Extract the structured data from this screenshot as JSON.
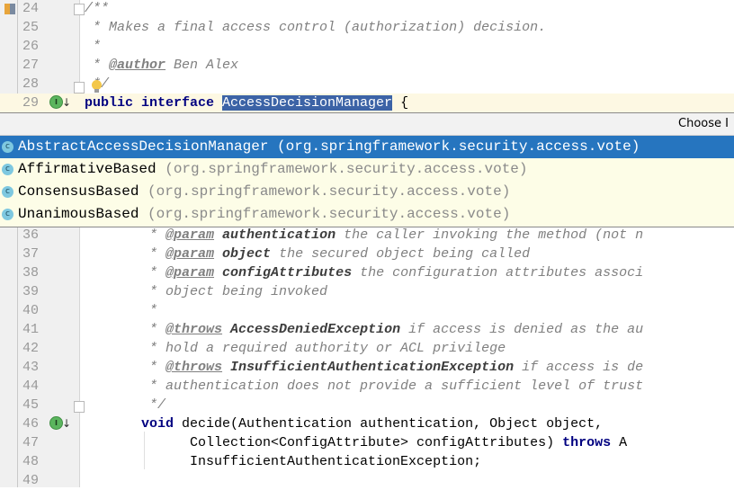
{
  "editor": {
    "lines_top": [
      {
        "num": "24",
        "parts": [
          {
            "t": "/**",
            "c": "cm"
          }
        ]
      },
      {
        "num": "25",
        "parts": [
          {
            "t": " * Makes a final access control (authorization) decision.",
            "c": "cm"
          }
        ]
      },
      {
        "num": "26",
        "parts": [
          {
            "t": " *",
            "c": "cm"
          }
        ]
      },
      {
        "num": "27",
        "parts": [
          {
            "t": " * ",
            "c": "cm"
          },
          {
            "t": "@author",
            "c": "tag"
          },
          {
            "t": " Ben Alex",
            "c": "cm"
          }
        ]
      },
      {
        "num": "28",
        "parts": [
          {
            "t": " */",
            "c": "cm"
          }
        ]
      },
      {
        "num": "29",
        "parts": [
          {
            "t": "public interface ",
            "c": "kw"
          },
          {
            "t": "AccessDecisionManager",
            "c": "sel"
          },
          {
            "t": " {",
            "c": ""
          }
        ]
      }
    ],
    "lines_bottom": [
      {
        "num": "36",
        "parts": [
          {
            "t": "        * ",
            "c": "cm"
          },
          {
            "t": "@param",
            "c": "tag"
          },
          {
            "t": " ",
            "c": "cm"
          },
          {
            "t": "authentication",
            "c": "pname"
          },
          {
            "t": " the caller invoking the method (not n",
            "c": "cm"
          }
        ]
      },
      {
        "num": "37",
        "parts": [
          {
            "t": "        * ",
            "c": "cm"
          },
          {
            "t": "@param",
            "c": "tag"
          },
          {
            "t": " ",
            "c": "cm"
          },
          {
            "t": "object",
            "c": "pname"
          },
          {
            "t": " the secured object being called",
            "c": "cm"
          }
        ]
      },
      {
        "num": "38",
        "parts": [
          {
            "t": "        * ",
            "c": "cm"
          },
          {
            "t": "@param",
            "c": "tag"
          },
          {
            "t": " ",
            "c": "cm"
          },
          {
            "t": "configAttributes",
            "c": "pname"
          },
          {
            "t": " the configuration attributes associ",
            "c": "cm"
          }
        ]
      },
      {
        "num": "39",
        "parts": [
          {
            "t": "        * object being invoked",
            "c": "cm"
          }
        ]
      },
      {
        "num": "40",
        "parts": [
          {
            "t": "        *",
            "c": "cm"
          }
        ]
      },
      {
        "num": "41",
        "parts": [
          {
            "t": "        * ",
            "c": "cm"
          },
          {
            "t": "@throws",
            "c": "tag"
          },
          {
            "t": " ",
            "c": "cm"
          },
          {
            "t": "AccessDeniedException",
            "c": "pname"
          },
          {
            "t": " if access is denied as the au",
            "c": "cm"
          }
        ]
      },
      {
        "num": "42",
        "parts": [
          {
            "t": "        * hold a required authority or ACL privilege",
            "c": "cm"
          }
        ]
      },
      {
        "num": "43",
        "parts": [
          {
            "t": "        * ",
            "c": "cm"
          },
          {
            "t": "@throws",
            "c": "tag"
          },
          {
            "t": " ",
            "c": "cm"
          },
          {
            "t": "InsufficientAuthenticationException",
            "c": "pname"
          },
          {
            "t": " if access is de",
            "c": "cm"
          }
        ]
      },
      {
        "num": "44",
        "parts": [
          {
            "t": "        * authentication does not provide a sufficient level of trust",
            "c": "cm"
          }
        ]
      },
      {
        "num": "45",
        "parts": [
          {
            "t": "        */",
            "c": "cm"
          }
        ]
      },
      {
        "num": "46",
        "parts": [
          {
            "t": "       ",
            "c": ""
          },
          {
            "t": "void",
            "c": "kw"
          },
          {
            "t": " decide(Authentication authentication, Object object,",
            "c": ""
          }
        ]
      },
      {
        "num": "47",
        "parts": [
          {
            "t": "             Collection<ConfigAttribute> configAttributes) ",
            "c": ""
          },
          {
            "t": "throws",
            "c": "kw"
          },
          {
            "t": " A",
            "c": ""
          }
        ]
      },
      {
        "num": "48",
        "parts": [
          {
            "t": "             InsufficientAuthenticationException;",
            "c": ""
          }
        ]
      },
      {
        "num": "49",
        "parts": [
          {
            "t": "",
            "c": ""
          }
        ]
      }
    ]
  },
  "popup": {
    "title": "Choose I",
    "items": [
      {
        "icon": "c",
        "name": "AbstractAccessDecisionManager",
        "package": " (org.springframework.security.access.vote)",
        "selected": true
      },
      {
        "icon": "c",
        "name": "AffirmativeBased",
        "package": " (org.springframework.security.access.vote)",
        "selected": false
      },
      {
        "icon": "c",
        "name": "ConsensusBased",
        "package": " (org.springframework.security.access.vote)",
        "selected": false
      },
      {
        "icon": "c",
        "name": "UnanimousBased",
        "package": " (org.springframework.security.access.vote)",
        "selected": false
      }
    ]
  }
}
